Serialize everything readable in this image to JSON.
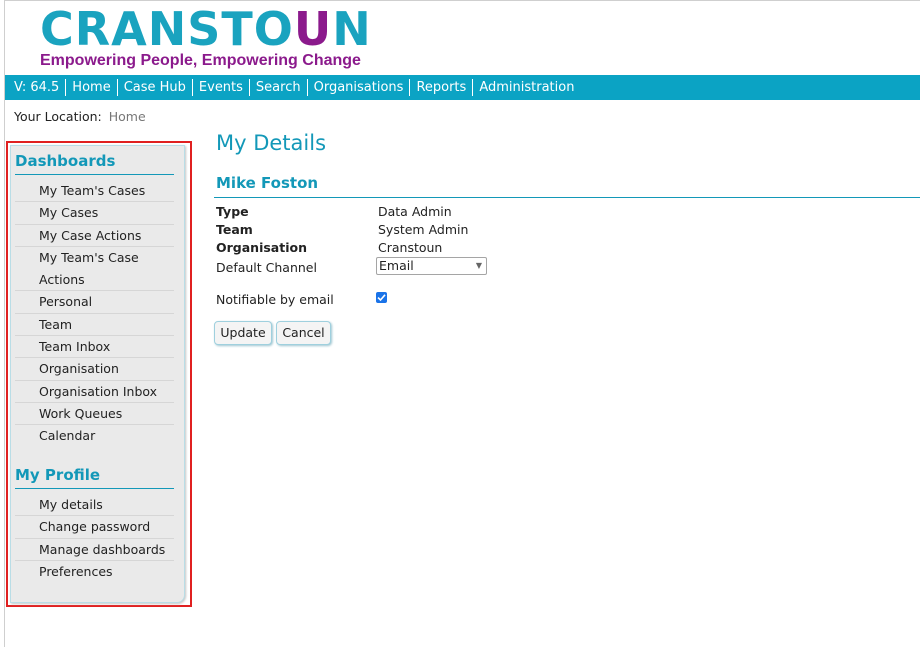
{
  "logo": {
    "text_before": "CRANSTO",
    "text_highlight": "U",
    "text_after": "N",
    "tagline": "Empowering People, Empowering Change",
    "colors": {
      "primary": "#1aa3bf",
      "accent": "#8b1a8c"
    }
  },
  "nav": {
    "items": [
      {
        "label": "V: 64.5"
      },
      {
        "label": "Home"
      },
      {
        "label": "Case Hub"
      },
      {
        "label": "Events"
      },
      {
        "label": "Search"
      },
      {
        "label": "Organisations"
      },
      {
        "label": "Reports"
      },
      {
        "label": "Administration"
      }
    ],
    "color": "#0ba3c4"
  },
  "location": {
    "label": "Your Location:",
    "value": "Home"
  },
  "sidebar": {
    "dashboards_heading": "Dashboards",
    "dashboards": [
      {
        "label": "My Team's Cases"
      },
      {
        "label": "My Cases"
      },
      {
        "label": "My Case Actions"
      },
      {
        "label": "My Team's Case"
      },
      {
        "label": "Actions"
      },
      {
        "label": "Personal"
      },
      {
        "label": "Team"
      },
      {
        "label": "Team Inbox"
      },
      {
        "label": "Organisation"
      },
      {
        "label": "Organisation Inbox"
      },
      {
        "label": "Work Queues"
      },
      {
        "label": "Calendar"
      }
    ],
    "profile_heading": "My Profile",
    "profile": [
      {
        "label": "My details"
      },
      {
        "label": "Change password"
      },
      {
        "label": "Manage dashboards"
      },
      {
        "label": "Preferences"
      }
    ]
  },
  "main": {
    "title": "My Details",
    "user_name": "Mike Foston",
    "fields": {
      "type": {
        "label": "Type",
        "value": "Data Admin"
      },
      "team": {
        "label": "Team",
        "value": "System Admin"
      },
      "organisation": {
        "label": "Organisation",
        "value": "Cranstoun"
      },
      "default_channel": {
        "label": "Default Channel",
        "value": "Email"
      },
      "notifiable": {
        "label": "Notifiable by email",
        "checked": true
      }
    },
    "buttons": {
      "update": "Update",
      "cancel": "Cancel"
    }
  }
}
